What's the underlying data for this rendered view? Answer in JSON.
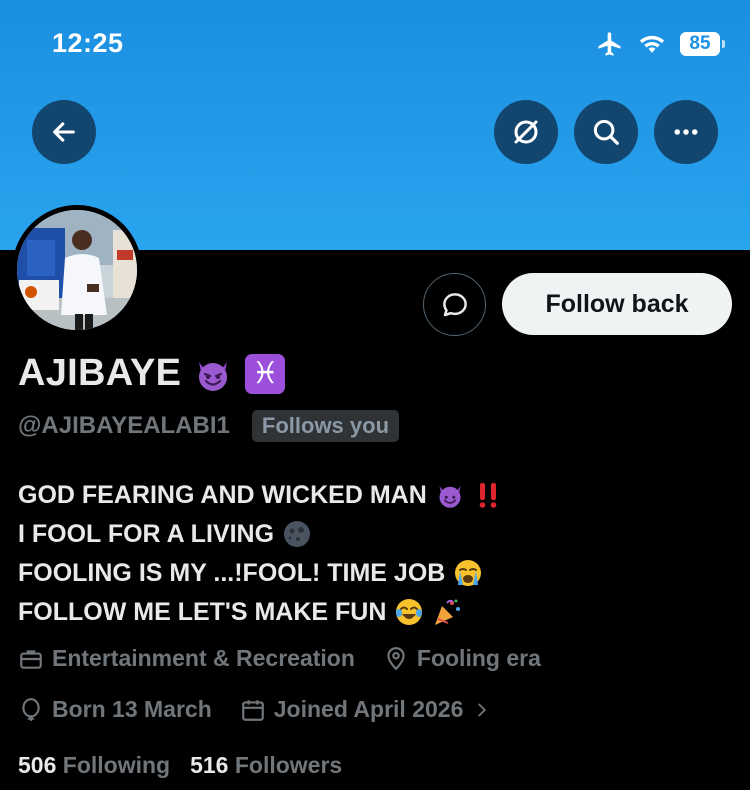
{
  "status_bar": {
    "time": "12:25",
    "battery": "85"
  },
  "header": {
    "back_icon": "arrow-left-icon",
    "action_icons": [
      "grok-icon",
      "search-icon",
      "more-icon"
    ]
  },
  "profile": {
    "display_name": "AJIBAYE",
    "handle": "@AJIBAYEALABI1",
    "follows_you_label": "Follows you",
    "follow_button_label": "Follow back",
    "name_emojis": [
      "smiling-devil-emoji",
      "pisces-emoji"
    ],
    "bio_lines": [
      {
        "text": "GOD FEARING AND WICKED MAN",
        "emojis": [
          "smiling-devil-emoji",
          "double-exclamation-emoji"
        ]
      },
      {
        "text": "I FOOL FOR A LIVING",
        "emojis": [
          "new-moon-face-emoji"
        ]
      },
      {
        "text": "FOOLING IS MY ...!FOOL! TIME JOB",
        "emojis": [
          "loudly-crying-emoji"
        ]
      },
      {
        "text": "FOLLOW ME LET'S MAKE FUN",
        "emojis": [
          "tears-of-joy-emoji",
          "party-popper-emoji"
        ]
      }
    ],
    "category": "Entertainment & Recreation",
    "location": "Fooling era",
    "birthday": "Born 13 March",
    "joined": "Joined April 2026",
    "following_count": "506",
    "following_label": "Following",
    "followers_count": "516",
    "followers_label": "Followers"
  },
  "colors": {
    "banner": "#1d92e4",
    "muted": "#71767b",
    "text": "#e7e9ea"
  }
}
